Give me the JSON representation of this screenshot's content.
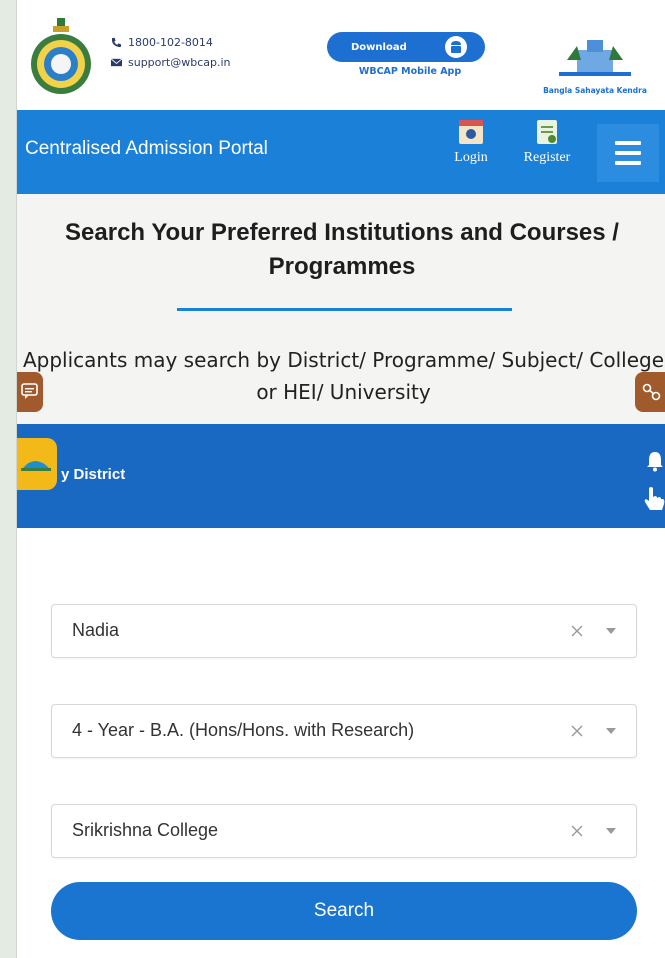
{
  "header": {
    "phone": "1800-102-8014",
    "email": "support@wbcap.in",
    "download_label": "Download",
    "download_caption": "WBCAP Mobile App",
    "bsk_caption": "Bangla Sahayata Kendra"
  },
  "nav": {
    "title": "Centralised Admission Portal",
    "login_label": "Login",
    "register_label": "Register"
  },
  "hero": {
    "title": "Search Your Preferred Institutions and Courses / Programmes",
    "subtitle": "Applicants may search by District/ Programme/ Subject/ College or HEI/ University"
  },
  "district_bar": {
    "label": "y District"
  },
  "form": {
    "district_value": "Nadia",
    "programme_value": "4 - Year - B.A. (Hons/Hons. with Research)",
    "college_value": "Srikrishna College",
    "search_label": "Search"
  },
  "colors": {
    "primary": "#1a80d8",
    "district_bar": "#1969c3",
    "search_button": "#1a75d1",
    "widget_brown": "#a15a2c",
    "widget_yellow": "#f2b918"
  },
  "icons": [
    "emblem-icon",
    "phone-icon",
    "mail-icon",
    "android-icon",
    "bsk-logo",
    "login-icon",
    "register-icon",
    "menu-icon",
    "chat-icon",
    "help-icon",
    "share-icon",
    "bell-icon",
    "hand-pointer-icon",
    "clear-icon",
    "chevron-down-icon"
  ]
}
